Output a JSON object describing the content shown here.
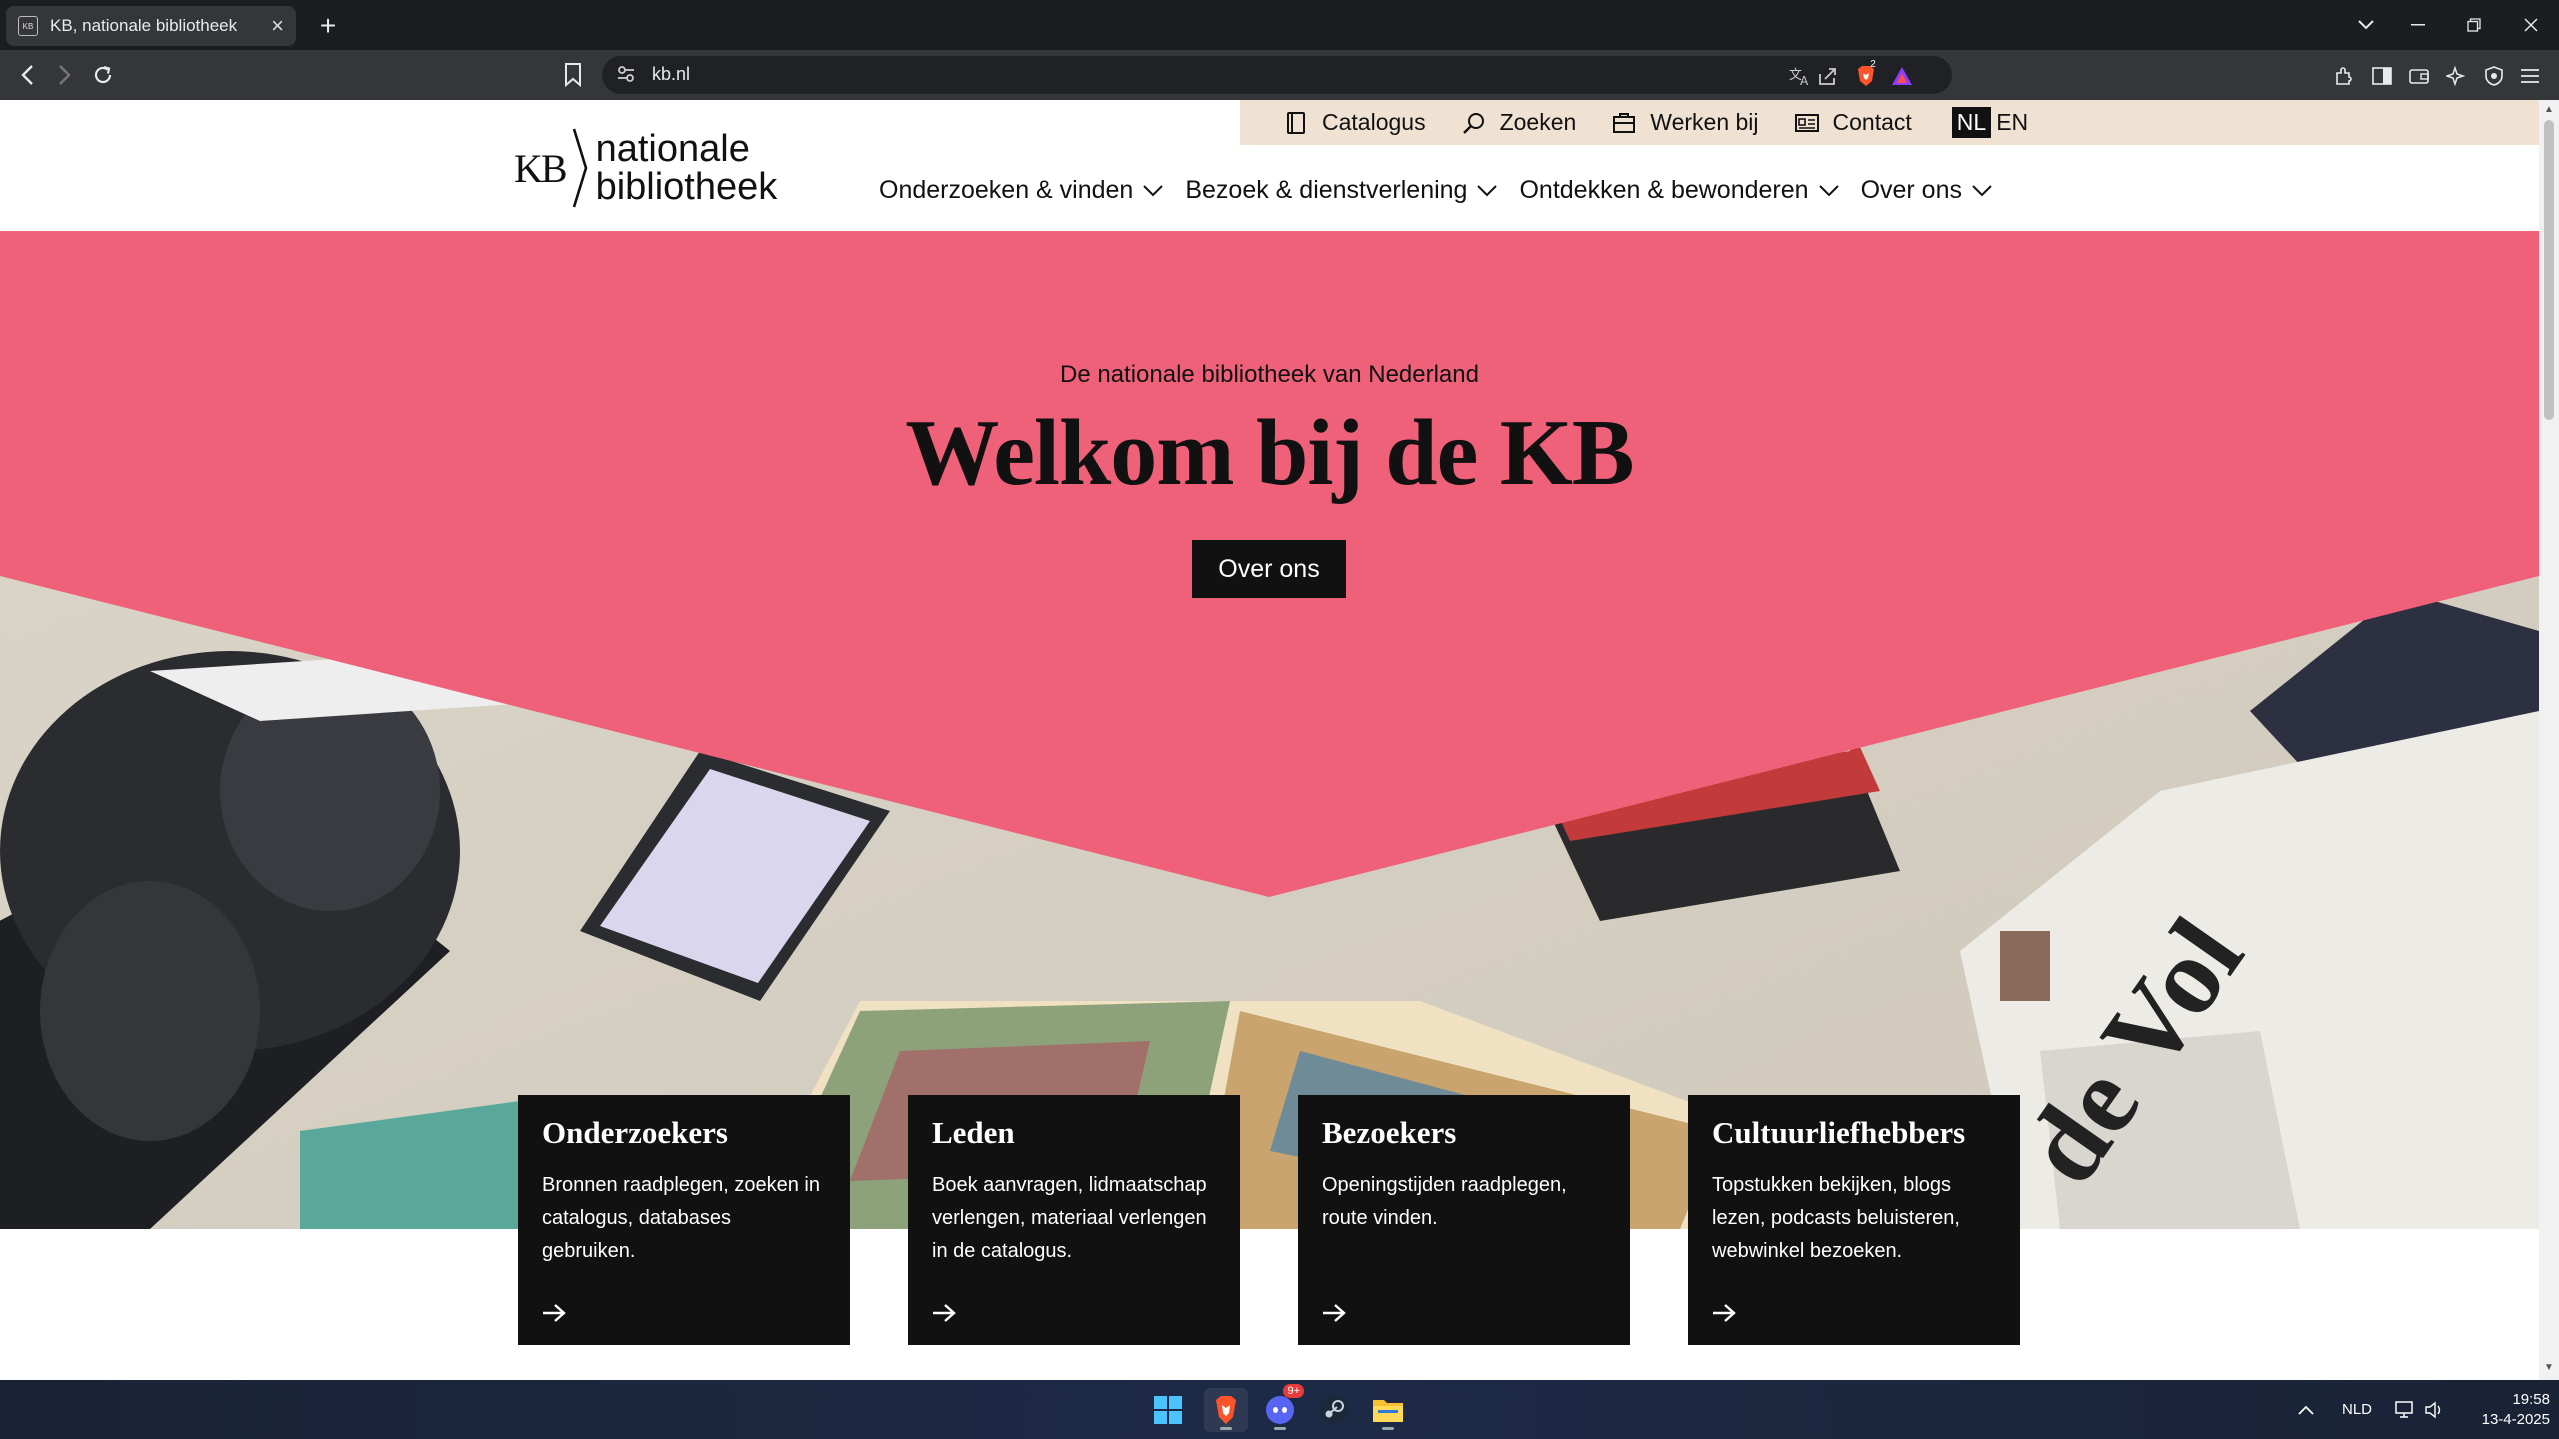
{
  "browser": {
    "tab_title": "KB, nationale bibliotheek",
    "tab_favicon_text": "KB",
    "url": "kb.nl",
    "brave_badge": "2"
  },
  "utility_nav": {
    "items": [
      {
        "label": "Catalogus",
        "icon": "book-icon"
      },
      {
        "label": "Zoeken",
        "icon": "search-icon"
      },
      {
        "label": "Werken bij",
        "icon": "briefcase-icon"
      },
      {
        "label": "Contact",
        "icon": "contact-card-icon"
      }
    ],
    "lang_active": "NL",
    "lang_other": "EN"
  },
  "logo": {
    "mark": "KB",
    "line1": "nationale",
    "line2": "bibliotheek"
  },
  "main_nav": {
    "items": [
      {
        "label": "Onderzoeken & vinden"
      },
      {
        "label": "Bezoek & dienstverlening"
      },
      {
        "label": "Ontdekken & bewonderen"
      },
      {
        "label": "Over ons"
      }
    ]
  },
  "hero": {
    "eyebrow": "De nationale bibliotheek van Nederland",
    "title": "Welkom bij de KB",
    "button": "Over ons",
    "pink": "#ef6079"
  },
  "cards": [
    {
      "title": "Onderzoekers",
      "text": "Bronnen raadplegen, zoeken in catalogus, databases gebruiken."
    },
    {
      "title": "Leden",
      "text": "Boek aanvragen, lidmaatschap verlengen, materiaal verlengen in de catalogus."
    },
    {
      "title": "Bezoekers",
      "text": "Openingstijden raadplegen, route vinden."
    },
    {
      "title": "Cultuurliefhebbers",
      "text": "Topstukken bekijken, blogs lezen, podcasts beluisteren, webwinkel bezoeken."
    }
  ],
  "taskbar": {
    "discord_badge": "9+",
    "language": "NLD",
    "time": "19:58",
    "date": "13-4-2025"
  }
}
